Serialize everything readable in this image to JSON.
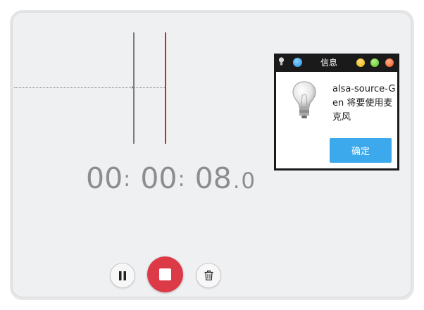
{
  "timer": {
    "hours": "00",
    "minutes": "00",
    "seconds": "08",
    "separator": ":",
    "decimal_point": ".",
    "tenths": "0"
  },
  "controls": {
    "pause_icon": "pause-icon",
    "stop_icon": "stop-icon",
    "delete_icon": "trash-icon",
    "stop_color": "#dc3a47"
  },
  "waveform": {
    "playhead_color": "#e0201a",
    "cursor_color": "#7d7d7d"
  },
  "dialog": {
    "title": "信息",
    "message": "alsa-source-Gen 将要使用麦克风",
    "ok_label": "确定",
    "ok_color": "#3ba9ec",
    "icons": {
      "app": "lightbulb-icon",
      "menu": "blue-ball-icon",
      "minimize": "yellow-dot",
      "maximize": "green-dot",
      "close": "orange-dot"
    }
  }
}
